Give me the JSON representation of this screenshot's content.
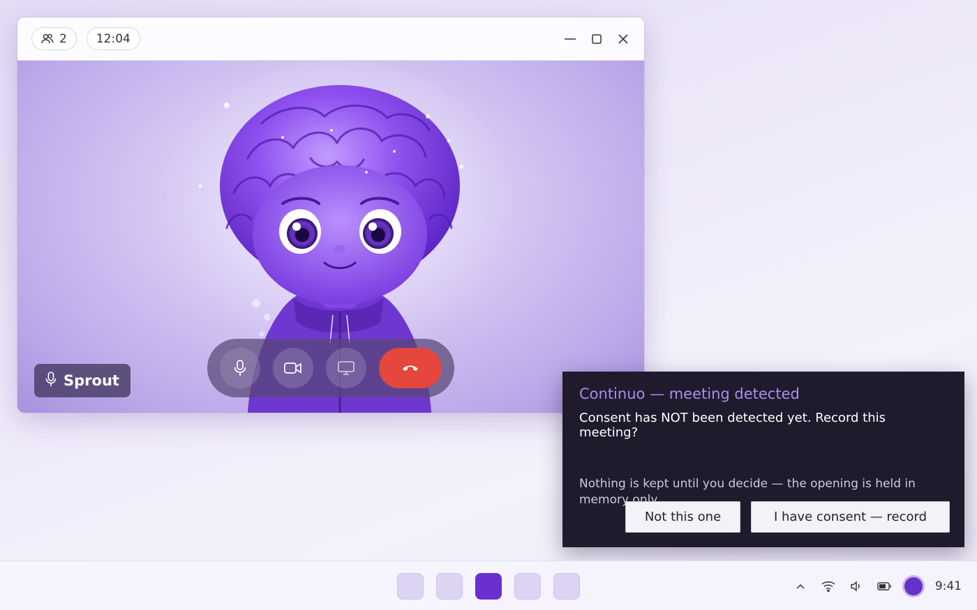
{
  "call": {
    "participants_count": "2",
    "duration": "12:04",
    "participant_name": "Sprout"
  },
  "toast": {
    "title": "Continuo — meeting detected",
    "message": "Consent has NOT been detected yet. Record this meeting?",
    "note": "Nothing is kept until you decide — the opening is held in memory only.",
    "decline_label": "Not this one",
    "accept_label": "I have consent — record"
  },
  "taskbar": {
    "clock": "9:41",
    "apps": [
      "app-1",
      "app-2",
      "app-3-active",
      "app-4",
      "app-5"
    ]
  },
  "colors": {
    "accent": "#6a2fd0",
    "toast_title": "#a98cf2",
    "end_call": "#e5463d",
    "toast_bg": "#1f1b2c"
  },
  "icons": {
    "participants": "people-icon",
    "mic": "microphone-icon",
    "camera": "video-camera-icon",
    "screen": "screen-share-icon",
    "end": "phone-hangup-icon"
  }
}
